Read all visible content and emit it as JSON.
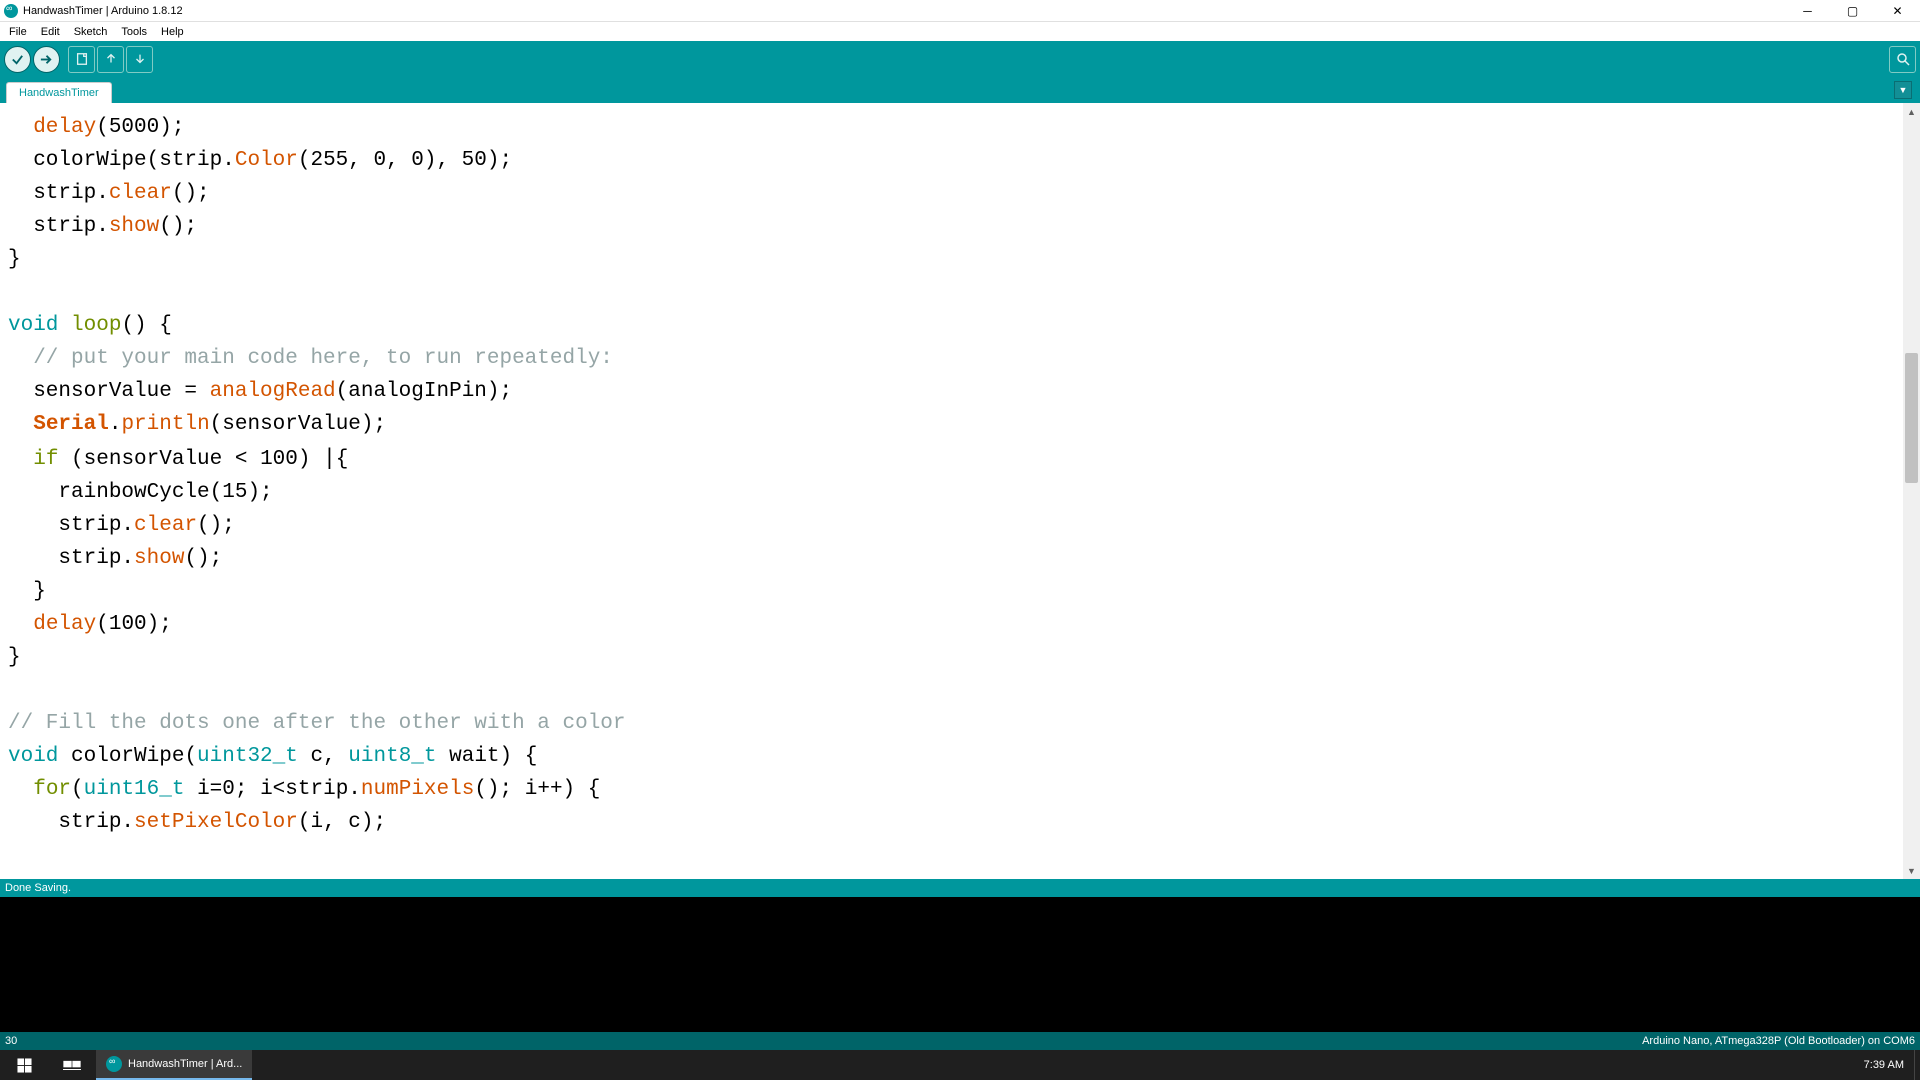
{
  "title": "HandwashTimer | Arduino 1.8.12",
  "menus": [
    "File",
    "Edit",
    "Sketch",
    "Tools",
    "Help"
  ],
  "tab_name": "HandwashTimer",
  "status": "Done Saving.",
  "footer_left": "30",
  "footer_right": "Arduino Nano, ATmega328P (Old Bootloader) on COM6",
  "taskbar_app": "HandwashTimer | Ard...",
  "clock": "7:39 AM",
  "code": [
    [
      {
        "c": "tok-orange",
        "t": "  delay"
      },
      {
        "t": "(5000);"
      }
    ],
    [
      {
        "t": "  colorWipe(strip."
      },
      {
        "c": "tok-orange",
        "t": "Color"
      },
      {
        "t": "(255, 0, 0), 50);"
      }
    ],
    [
      {
        "t": "  strip."
      },
      {
        "c": "tok-orange",
        "t": "clear"
      },
      {
        "t": "();"
      }
    ],
    [
      {
        "t": "  strip."
      },
      {
        "c": "tok-orange",
        "t": "show"
      },
      {
        "t": "();"
      }
    ],
    [
      {
        "t": "}"
      }
    ],
    [
      {
        "t": ""
      }
    ],
    [
      {
        "c": "tok-teal",
        "t": "void"
      },
      {
        "t": " "
      },
      {
        "c": "tok-olive",
        "t": "loop"
      },
      {
        "t": "() {"
      }
    ],
    [
      {
        "c": "tok-gray",
        "t": "  // put your main code here, to run repeatedly:"
      }
    ],
    [
      {
        "t": "  sensorValue = "
      },
      {
        "c": "tok-orange",
        "t": "analogRead"
      },
      {
        "t": "(analogInPin);"
      }
    ],
    [
      {
        "t": "  "
      },
      {
        "c": "tok-bold-orange",
        "t": "Serial"
      },
      {
        "t": "."
      },
      {
        "c": "tok-orange",
        "t": "println"
      },
      {
        "t": "(sensorValue);"
      }
    ],
    [
      {
        "t": "  "
      },
      {
        "c": "tok-olive",
        "t": "if"
      },
      {
        "t": " (sensorValue < 100) "
      },
      {
        "c": "cursor",
        "t": "|"
      },
      {
        "t": "{"
      }
    ],
    [
      {
        "t": "    rainbowCycle(15);"
      }
    ],
    [
      {
        "t": "    strip."
      },
      {
        "c": "tok-orange",
        "t": "clear"
      },
      {
        "t": "();"
      }
    ],
    [
      {
        "t": "    strip."
      },
      {
        "c": "tok-orange",
        "t": "show"
      },
      {
        "t": "();"
      }
    ],
    [
      {
        "t": "  }"
      }
    ],
    [
      {
        "t": "  "
      },
      {
        "c": "tok-orange",
        "t": "delay"
      },
      {
        "t": "(100);"
      }
    ],
    [
      {
        "t": "}"
      }
    ],
    [
      {
        "t": ""
      }
    ],
    [
      {
        "c": "tok-gray",
        "t": "// Fill the dots one after the other with a color"
      }
    ],
    [
      {
        "c": "tok-teal",
        "t": "void"
      },
      {
        "t": " colorWipe("
      },
      {
        "c": "tok-teal",
        "t": "uint32_t"
      },
      {
        "t": " c, "
      },
      {
        "c": "tok-teal",
        "t": "uint8_t"
      },
      {
        "t": " wait) {"
      }
    ],
    [
      {
        "t": "  "
      },
      {
        "c": "tok-olive",
        "t": "for"
      },
      {
        "t": "("
      },
      {
        "c": "tok-teal",
        "t": "uint16_t"
      },
      {
        "t": " i=0; i<strip."
      },
      {
        "c": "tok-orange",
        "t": "numPixels"
      },
      {
        "t": "(); i++) {"
      }
    ],
    [
      {
        "t": "    strip."
      },
      {
        "c": "tok-orange",
        "t": "setPixelColor"
      },
      {
        "t": "(i, c);"
      }
    ]
  ]
}
